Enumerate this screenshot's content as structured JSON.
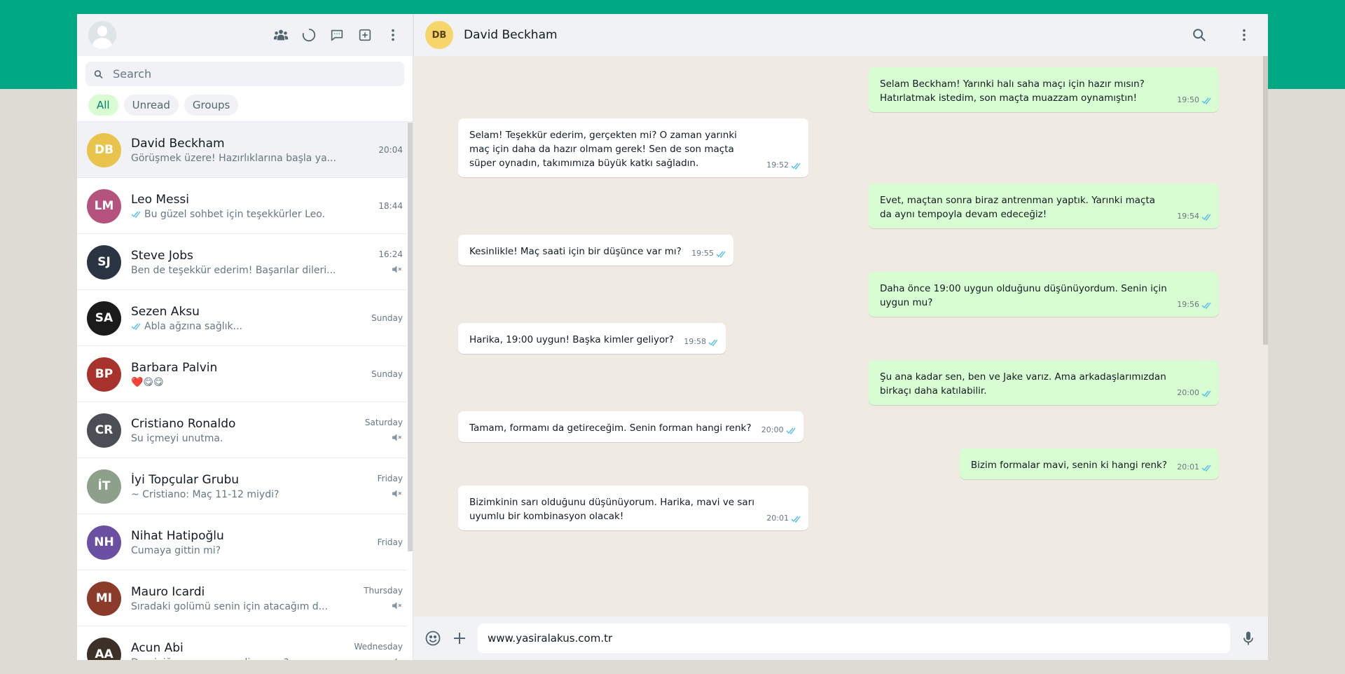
{
  "sidebar": {
    "search_placeholder": "Search",
    "header_icons": [
      "communities-icon",
      "status-icon",
      "channels-icon",
      "new-chat-icon",
      "menu-icon"
    ],
    "filters": [
      {
        "label": "All",
        "active": true
      },
      {
        "label": "Unread",
        "active": false
      },
      {
        "label": "Groups",
        "active": false
      }
    ],
    "chats": [
      {
        "name": "David Beckham",
        "preview": "Görüşmek üzere! Hazırlıklarına başla ya...",
        "time": "20:04",
        "ticks": false,
        "muted": false,
        "active": true,
        "avatar_color": "#e9c44c",
        "initials": "DB"
      },
      {
        "name": "Leo Messi",
        "preview": "Bu güzel sohbet için teşekkürler Leo.",
        "time": "18:44",
        "ticks": true,
        "muted": false,
        "active": false,
        "avatar_color": "#b5537e",
        "initials": "LM"
      },
      {
        "name": "Steve Jobs",
        "preview": "Ben de teşekkür ederim! Başarılar dileri...",
        "time": "16:24",
        "ticks": false,
        "muted": true,
        "active": false,
        "avatar_color": "#2a3442",
        "initials": "SJ"
      },
      {
        "name": "Sezen Aksu",
        "preview": "Abla ağzına sağlık...",
        "time": "Sunday",
        "ticks": true,
        "muted": false,
        "active": false,
        "avatar_color": "#1b1b1b",
        "initials": "SA"
      },
      {
        "name": "Barbara Palvin",
        "preview": "❤️😋😋",
        "time": "Sunday",
        "ticks": false,
        "muted": false,
        "active": false,
        "avatar_color": "#a8322c",
        "initials": "BP"
      },
      {
        "name": "Cristiano Ronaldo",
        "preview": "Su içmeyi unutma.",
        "time": "Saturday",
        "ticks": false,
        "muted": true,
        "active": false,
        "avatar_color": "#4b4f55",
        "initials": "CR"
      },
      {
        "name": "İyi Topçular Grubu",
        "preview": "~ Cristiano: Maç 11-12 miydi?",
        "time": "Friday",
        "ticks": false,
        "muted": true,
        "active": false,
        "avatar_color": "#8ca08a",
        "initials": "İT"
      },
      {
        "name": "Nihat Hatipoğlu",
        "preview": "Cumaya gittin mi?",
        "time": "Friday",
        "ticks": false,
        "muted": false,
        "active": false,
        "avatar_color": "#6a4fa3",
        "initials": "NH"
      },
      {
        "name": "Mauro Icardi",
        "preview": "Sıradaki golümü senin için atacağım d...",
        "time": "Thursday",
        "ticks": false,
        "muted": true,
        "active": false,
        "avatar_color": "#8c3b2b",
        "initials": "MI"
      },
      {
        "name": "Acun Abi",
        "preview": "Dominiğe ne zaman geliyorsun?",
        "time": "Wednesday",
        "ticks": false,
        "muted": true,
        "active": false,
        "avatar_color": "#3d3127",
        "initials": "AA"
      }
    ]
  },
  "chat": {
    "contact_name": "David Beckham",
    "contact_initials": "DB",
    "messages": [
      {
        "dir": "out",
        "text": "Selam Beckham! Yarınki halı saha maçı için hazır mısın? Hatırlatmak istedim, son maçta muazzam oynamıştın!",
        "time": "19:50"
      },
      {
        "dir": "in",
        "text": "Selam! Teşekkür ederim, gerçekten mi? O zaman yarınki maç için daha da hazır olmam gerek! Sen de son maçta süper oynadın, takımımıza büyük katkı sağladın.",
        "time": "19:52"
      },
      {
        "dir": "out",
        "text": "Evet, maçtan sonra biraz antrenman yaptık. Yarınki maçta da aynı tempoyla devam edeceğiz!",
        "time": "19:54"
      },
      {
        "dir": "in",
        "text": "Kesinlikle! Maç saati için bir düşünce var mı?",
        "time": "19:55"
      },
      {
        "dir": "out",
        "text": "Daha önce 19:00 uygun olduğunu düşünüyordum. Senin için uygun mu?",
        "time": "19:56"
      },
      {
        "dir": "in",
        "text": "Harika, 19:00 uygun! Başka kimler geliyor?",
        "time": "19:58"
      },
      {
        "dir": "out",
        "text": "Şu ana kadar sen, ben ve Jake varız. Ama arkadaşlarımızdan birkaçı daha katılabilir.",
        "time": "20:00"
      },
      {
        "dir": "in",
        "text": "Tamam, formamı da getireceğim. Senin forman hangi renk?",
        "time": "20:00"
      },
      {
        "dir": "out",
        "text": "Bizim formalar mavi, senin ki hangi renk?",
        "time": "20:01"
      },
      {
        "dir": "in",
        "text": "Bizimkinin sarı olduğunu düşünüyorum. Harika, mavi ve sarı uyumlu bir kombinasyon olacak!",
        "time": "20:01"
      }
    ],
    "composer_value": "www.yasiralakus.com.tr"
  }
}
